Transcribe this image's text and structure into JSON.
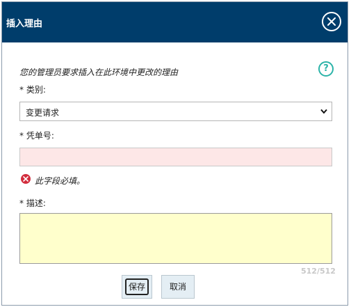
{
  "dialog": {
    "title": "插入理由",
    "instruction": "您的管理员要求插入在此环境中更改的理由",
    "help_glyph": "?",
    "category_label": "* 类别:",
    "category_value": "变更请求",
    "ticket_label": "* 凭单号:",
    "ticket_value": "",
    "error_text": "此字段必填。",
    "description_label": "* 描述:",
    "description_value": "",
    "counter": "512/512",
    "save_label": "保存",
    "cancel_label": "取消"
  },
  "icons": {
    "close": "close-circle-icon",
    "help": "question-circle-icon",
    "error": "error-x-circle-icon",
    "dropdown": "chevron-down-icon"
  },
  "colors": {
    "titlebar": "#003d6b",
    "help": "#2bb3a8",
    "error": "#d22d3d",
    "required_input_bg": "#fde7e7",
    "textarea_bg": "#ffffcc",
    "button_bg": "#e4eef4"
  }
}
